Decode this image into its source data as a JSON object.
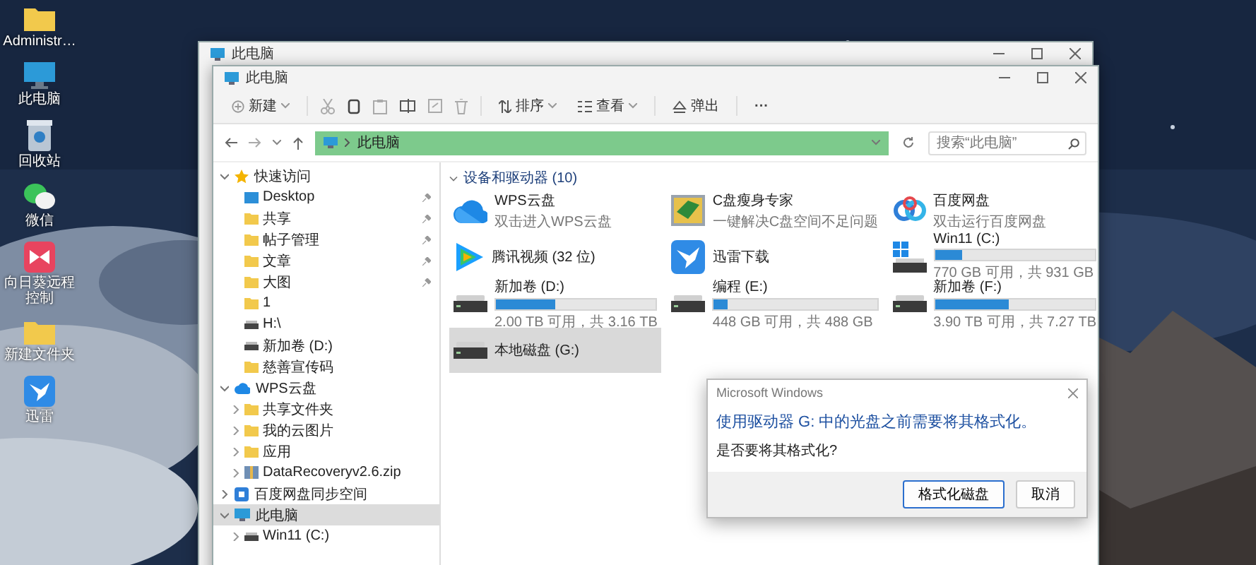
{
  "desktop_icons": [
    {
      "label": "Administr…",
      "kind": "folder"
    },
    {
      "label": "此电脑",
      "kind": "pc"
    },
    {
      "label": "回收站",
      "kind": "recycle"
    },
    {
      "label": "微信",
      "kind": "chat"
    },
    {
      "label": "向日葵远程控制",
      "kind": "remote"
    },
    {
      "label": "新建文件夹",
      "kind": "folder"
    },
    {
      "label": "迅雷",
      "kind": "bird"
    }
  ],
  "back_window": {
    "title": "此电脑"
  },
  "window": {
    "title": "此电脑",
    "toolbar": [
      {
        "kind": "new",
        "label": "新建"
      },
      {
        "kind": "cut"
      },
      {
        "kind": "copy"
      },
      {
        "kind": "paste"
      },
      {
        "kind": "rename"
      },
      {
        "kind": "share"
      },
      {
        "kind": "delete"
      },
      {
        "kind": "sort",
        "label": "排序"
      },
      {
        "kind": "view",
        "label": "查看"
      },
      {
        "kind": "eject",
        "label": "弹出"
      },
      {
        "kind": "more",
        "label": "···"
      }
    ],
    "address": "此电脑",
    "search": {
      "placeholder": "搜索“此电脑”"
    },
    "nav": [
      {
        "label": "快速访问",
        "kind": "star",
        "expanded": true,
        "selected": false,
        "children": [
          {
            "label": "Desktop",
            "kind": "desktop",
            "pinned": true,
            "selected": false
          },
          {
            "label": "共享",
            "kind": "folder",
            "pinned": true,
            "selected": false
          },
          {
            "label": "帖子管理",
            "kind": "folder",
            "pinned": true,
            "selected": false
          },
          {
            "label": "文章",
            "kind": "folder",
            "pinned": true,
            "selected": false
          },
          {
            "label": "大图",
            "kind": "folder",
            "pinned": true,
            "selected": false
          },
          {
            "label": "1",
            "kind": "folder",
            "pinned": false,
            "selected": false
          },
          {
            "label": "H:\\",
            "kind": "drive",
            "pinned": false,
            "selected": false
          },
          {
            "label": "新加卷 (D:)",
            "kind": "drive",
            "pinned": false,
            "selected": false
          },
          {
            "label": "慈善宣传码",
            "kind": "folder",
            "pinned": false,
            "selected": false
          }
        ]
      },
      {
        "label": "WPS云盘",
        "kind": "cloud",
        "expanded": true,
        "selected": false,
        "children": [
          {
            "label": "共享文件夹",
            "kind": "folder",
            "expanded": false,
            "selected": false
          },
          {
            "label": "我的云图片",
            "kind": "folder",
            "expanded": false,
            "selected": false
          },
          {
            "label": "应用",
            "kind": "folder",
            "expanded": false,
            "selected": false
          },
          {
            "label": "DataRecoveryv2.6.zip",
            "kind": "zip",
            "expanded": false,
            "selected": false
          }
        ]
      },
      {
        "label": "百度网盘同步空间",
        "kind": "sync",
        "expanded": false,
        "selected": false
      },
      {
        "label": "此电脑",
        "kind": "pc",
        "expanded": true,
        "selected": true,
        "children": [
          {
            "label": "Win11 (C:)",
            "kind": "drive",
            "expanded": false,
            "selected": false
          }
        ]
      }
    ],
    "section": {
      "title": "设备和驱动器 (10)",
      "expanded": true
    },
    "items": [
      {
        "kind": "cloudapp",
        "name": "WPS云盘",
        "subtitle": "双击进入WPS云盘",
        "selected": false
      },
      {
        "kind": "cleanerapp",
        "name": "C盘瘦身专家",
        "subtitle": "一键解决C盘空间不足问题",
        "selected": false
      },
      {
        "kind": "baiduapp",
        "name": "百度网盘",
        "subtitle": "双击运行百度网盘",
        "selected": false
      },
      {
        "kind": "videoapp",
        "name": "腾讯视频 (32 位)",
        "selected": false
      },
      {
        "kind": "downloaderapp",
        "name": "迅雷下载",
        "selected": false
      },
      {
        "kind": "systemdrive",
        "name": "Win11 (C:)",
        "level": 0.17,
        "free": "770 GB 可用，共 931 GB",
        "selected": false
      },
      {
        "kind": "drive",
        "name": "新加卷 (D:)",
        "level": 0.37,
        "free": "2.00 TB 可用，共 3.16 TB",
        "selected": false
      },
      {
        "kind": "drive",
        "name": "编程 (E:)",
        "level": 0.08,
        "free": "448 GB 可用，共 488 GB",
        "selected": false
      },
      {
        "kind": "drive",
        "name": "新加卷 (F:)",
        "level": 0.46,
        "free": "3.90 TB 可用，共 7.27 TB",
        "selected": false
      },
      {
        "kind": "drive",
        "name": "本地磁盘 (G:)",
        "selected": true
      }
    ]
  },
  "dialog": {
    "title": "Microsoft Windows",
    "message": "使用驱动器 G: 中的光盘之前需要将其格式化。",
    "question": "是否要将其格式化?",
    "buttons": [
      {
        "label": "格式化磁盘",
        "kind": "primary"
      },
      {
        "label": "取消",
        "kind": "secondary"
      }
    ]
  }
}
